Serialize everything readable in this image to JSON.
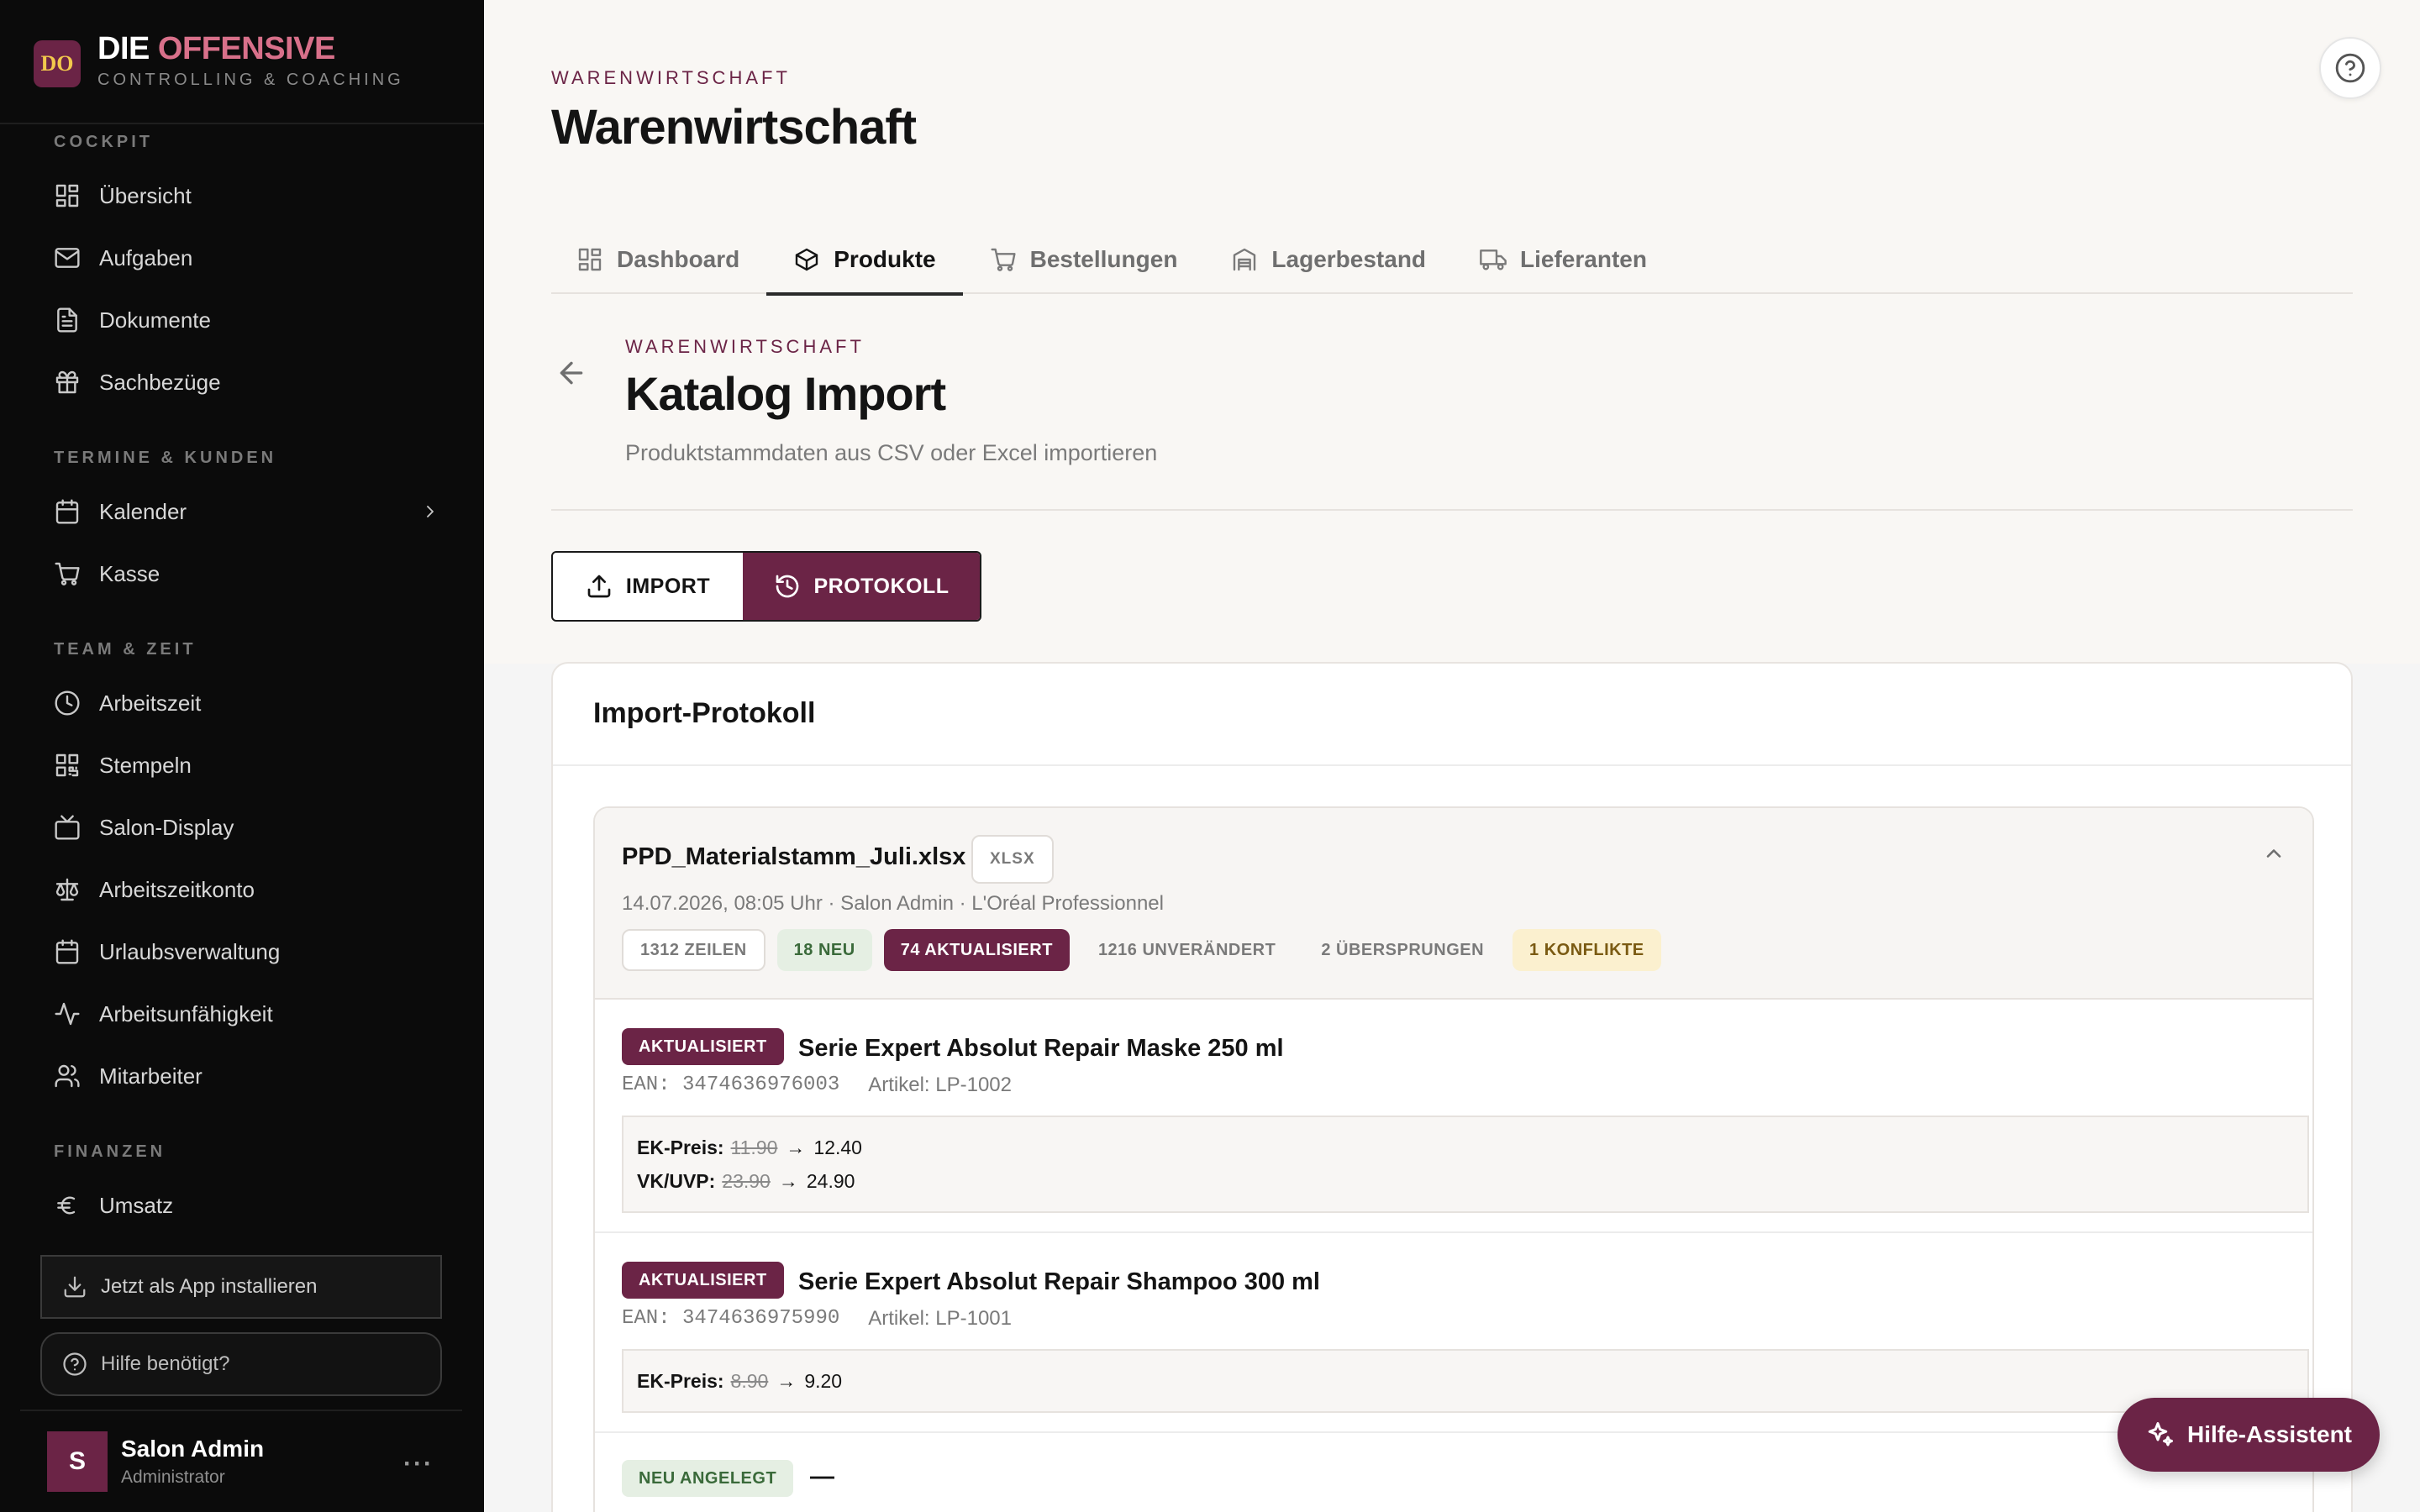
{
  "brand": {
    "logo": "DO",
    "name_part1": "DIE",
    "name_part2": "OFFENSIVE",
    "subtitle": "CONTROLLING & COACHING",
    "accent_color": "#d8708a",
    "logo_color": "#6b2446"
  },
  "sidebar": {
    "sections": {
      "cockpit": "COCKPIT",
      "termine": "TERMINE & KUNDEN",
      "team": "TEAM & ZEIT",
      "finanzen": "FINANZEN"
    },
    "items": [
      {
        "label": "Übersicht",
        "icon": "dashboard-icon"
      },
      {
        "label": "Aufgaben",
        "icon": "mail-icon"
      },
      {
        "label": "Dokumente",
        "icon": "document-icon"
      },
      {
        "label": "Sachbezüge",
        "icon": "gift-icon"
      },
      {
        "label": "Kalender",
        "icon": "calendar-icon"
      },
      {
        "label": "Kasse",
        "icon": "cart-icon"
      },
      {
        "label": "Arbeitszeit",
        "icon": "clock-icon"
      },
      {
        "label": "Stempeln",
        "icon": "qr-code-icon"
      },
      {
        "label": "Salon-Display",
        "icon": "tv-icon"
      },
      {
        "label": "Arbeitszeitkonto",
        "icon": "scale-icon"
      },
      {
        "label": "Urlaubsverwaltung",
        "icon": "calendar-icon"
      },
      {
        "label": "Arbeitsunfähigkeit",
        "icon": "activity-icon"
      },
      {
        "label": "Mitarbeiter",
        "icon": "users-icon"
      },
      {
        "label": "Umsatz",
        "icon": "euro-icon"
      }
    ],
    "install_label": "Jetzt als App installieren",
    "help_label": "Hilfe benötigt?",
    "user": {
      "initial": "S",
      "name": "Salon Admin",
      "role": "Administrator",
      "more": "···"
    }
  },
  "header": {
    "eyebrow": "WARENWIRTSCHAFT",
    "title": "Warenwirtschaft",
    "tabs": [
      {
        "label": "Dashboard",
        "icon": "dashboard-icon"
      },
      {
        "label": "Produkte",
        "icon": "package-icon"
      },
      {
        "label": "Bestellungen",
        "icon": "cart-icon"
      },
      {
        "label": "Lagerbestand",
        "icon": "warehouse-icon"
      },
      {
        "label": "Lieferanten",
        "icon": "truck-icon"
      }
    ],
    "active_tab": "Produkte"
  },
  "subpage": {
    "eyebrow": "WARENWIRTSCHAFT",
    "title": "Katalog Import",
    "description": "Produktstammdaten aus CSV oder Excel importieren"
  },
  "segment": {
    "import_label": "IMPORT",
    "protocol_label": "PROTOKOLL",
    "active": "PROTOKOLL"
  },
  "protocol": {
    "title": "Import-Protokoll",
    "entry": {
      "file_name": "PPD_Materialstamm_Juli.xlsx",
      "file_type": "XLSX",
      "meta": "14.07.2026, 08:05 Uhr · Salon Admin · L'Oréal Professionnel",
      "stats": {
        "rows": "1312 ZEILEN",
        "new": "18 NEU",
        "updated": "74 AKTUALISIERT",
        "unchanged": "1216 UNVERÄNDERT",
        "skipped": "2 ÜBERSPRUNGEN",
        "conflicts": "1 KONFLIKTE"
      },
      "rows": [
        {
          "badge": "AKTUALISIERT",
          "title": "Serie Expert Absolut Repair Maske 250 ml",
          "ean": "EAN: 3474636976003",
          "article": "Artikel: LP-1002",
          "changes": [
            {
              "field": "EK-Preis:",
              "old": "11.90",
              "arrow": "→",
              "new": "12.40"
            },
            {
              "field": "VK/UVP:",
              "old": "23.90",
              "arrow": "→",
              "new": "24.90"
            }
          ]
        },
        {
          "badge": "AKTUALISIERT",
          "title": "Serie Expert Absolut Repair Shampoo 300 ml",
          "ean": "EAN: 3474636975990",
          "article": "Artikel: LP-1001",
          "changes": [
            {
              "field": "EK-Preis:",
              "old": "8.90",
              "arrow": "→",
              "new": "9.20"
            }
          ]
        },
        {
          "badge": "NEU ANGELEGT",
          "title": "—"
        }
      ]
    }
  },
  "assistant": {
    "label": "Hilfe-Assistent",
    "icon": "sparkle-icon"
  },
  "colors": {
    "primary": "#6b2446",
    "sidebar_bg": "#0b0b0b",
    "new_bg": "#e5efe3",
    "conflict_bg": "#fbf0cf"
  }
}
